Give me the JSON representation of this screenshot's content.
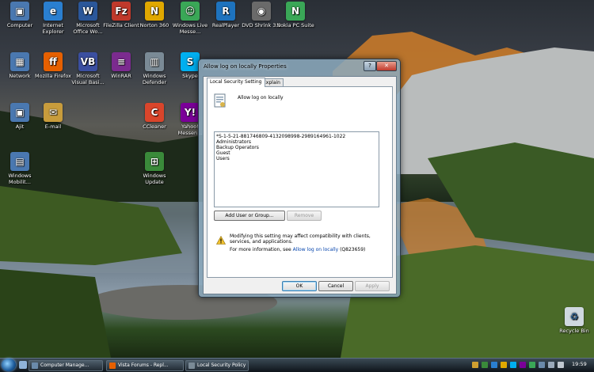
{
  "desktop": {
    "icons": [
      {
        "label": "Computer",
        "glyph": "▣",
        "color": "#4a78b0"
      },
      {
        "label": "Internet Explorer",
        "glyph": "e",
        "color": "#2a7fd0"
      },
      {
        "label": "Microsoft Office Wo...",
        "glyph": "W",
        "color": "#2b579a"
      },
      {
        "label": "FileZilla Client",
        "glyph": "Fz",
        "color": "#c0392b"
      },
      {
        "label": "Norton 360",
        "glyph": "N",
        "color": "#e0a800"
      },
      {
        "label": "Windows Live Messe...",
        "glyph": "☺",
        "color": "#3aa757"
      },
      {
        "label": "RealPlayer",
        "glyph": "R",
        "color": "#1e73be"
      },
      {
        "label": "DVD Shrink 3.2",
        "glyph": "◉",
        "color": "#6a6a6a"
      },
      {
        "label": "Nokia PC Suite",
        "glyph": "N",
        "color": "#3aa757"
      },
      {
        "label": "Network",
        "glyph": "▦",
        "color": "#4a78b0"
      },
      {
        "label": "Mozilla Firefox",
        "glyph": "ff",
        "color": "#e66000"
      },
      {
        "label": "Microsoft Visual Basi...",
        "glyph": "VB",
        "color": "#3b4fa0"
      },
      {
        "label": "WinRAR",
        "glyph": "≡",
        "color": "#7b2b8f"
      },
      {
        "label": "Windows Defender",
        "glyph": "▥",
        "color": "#7a8a96"
      },
      {
        "label": "Skype",
        "glyph": "S",
        "color": "#00aff0"
      },
      {
        "label": "Ajit",
        "glyph": "▣",
        "color": "#4a78b0"
      },
      {
        "label": "E-mail",
        "glyph": "✉",
        "color": "#c89c3c"
      },
      {
        "label": "CCleaner",
        "glyph": "C",
        "color": "#d9452b"
      },
      {
        "label": "Yahoo! Messen...",
        "glyph": "Y!",
        "color": "#7b0099"
      },
      {
        "label": "Windows Mobilit...",
        "glyph": "▤",
        "color": "#4a78b0"
      },
      {
        "label": "Windows Update",
        "glyph": "⊞",
        "color": "#3a8a3a"
      }
    ],
    "recycle_bin_label": "Recycle Bin",
    "recycle_bin_glyph": "♻"
  },
  "dialog": {
    "title": "Allow log on locally Properties",
    "help_glyph": "?",
    "close_glyph": "✕",
    "tabs": [
      "Local Security Setting",
      "Explain"
    ],
    "policy_name": "Allow log on locally",
    "accounts": [
      "*S-1-5-21-881746809-4132098998-2989164961-1022",
      "Administrators",
      "Backup Operators",
      "Guest",
      "Users"
    ],
    "add_button": "Add User or Group...",
    "remove_button": "Remove",
    "warning_text": "Modifying this setting may affect compatibility with clients, services, and applications.",
    "more_info_prefix": "For more information, see",
    "more_info_link": "Allow log on locally",
    "more_info_suffix": "(Q823659)",
    "ok_button": "OK",
    "cancel_button": "Cancel",
    "apply_button": "Apply"
  },
  "taskbar": {
    "tasks": [
      {
        "label": "Computer Manage...",
        "icon_color": "#6a8aaa"
      },
      {
        "label": "Vista Forums - Repl...",
        "icon_color": "#e66000"
      },
      {
        "label": "Local Security Policy",
        "icon_color": "#7a8a96"
      }
    ],
    "clock": "19:59",
    "accent": "#1d5b9a"
  }
}
